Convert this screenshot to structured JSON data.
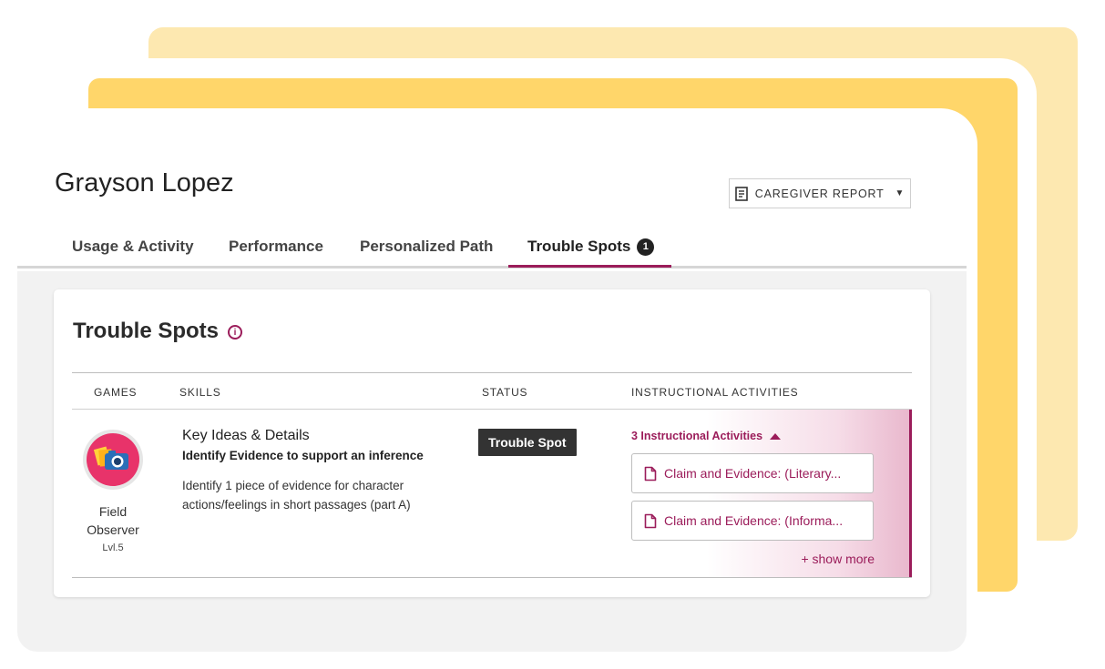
{
  "student": {
    "name": "Grayson Lopez"
  },
  "report_button": {
    "label": "CAREGIVER REPORT",
    "icon": "document-icon",
    "caret": "▼"
  },
  "tabs": [
    {
      "label": "Usage & Activity"
    },
    {
      "label": "Performance"
    },
    {
      "label": "Personalized Path"
    },
    {
      "label": "Trouble Spots",
      "badge": "1",
      "active": true
    }
  ],
  "panel": {
    "title": "Trouble Spots",
    "info_icon": "info-icon"
  },
  "table": {
    "headers": {
      "games": "GAMES",
      "skills": "SKILLS",
      "status": "STATUS",
      "activities": "INSTRUCTIONAL ACTIVITIES"
    },
    "row": {
      "game": {
        "name": "Field Observer",
        "level": "Lvl.5",
        "icon": "camera-icon"
      },
      "skill": {
        "category": "Key Ideas & Details",
        "title": "Identify Evidence to support an inference",
        "description": "Identify 1 piece of evidence for character actions/feelings in short passages (part A)"
      },
      "status": "Trouble Spot",
      "activities": {
        "toggle_label": "3 Instructional Activities",
        "items": [
          {
            "label": "Claim and Evidence: (Literary..."
          },
          {
            "label": "Claim and Evidence: (Informa..."
          }
        ],
        "show_more": "+ show more"
      }
    }
  },
  "colors": {
    "accent": "#9b1c5a",
    "back_card": "#fde8b0",
    "mid_card": "#ffd66a",
    "status_badge": "#333333",
    "content_bg": "#f2f2f2"
  }
}
